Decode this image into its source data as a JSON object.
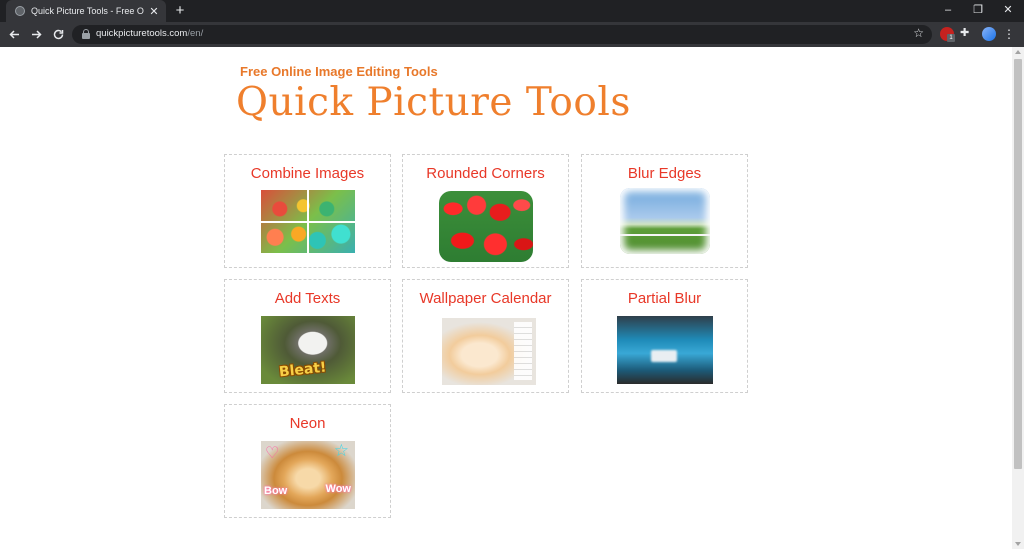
{
  "browser": {
    "tab_title": "Quick Picture Tools - Free Online",
    "tab_close": "✕",
    "new_tab": "+",
    "url_host": "quickpicturetools.com",
    "url_path": "/en/",
    "extension_badge": "1",
    "window_controls": {
      "minimize": "–",
      "restore": "❐",
      "close": "✕"
    },
    "icons": [
      "back-icon",
      "forward-icon",
      "reload-icon",
      "lock-icon",
      "star-icon",
      "puzzle-icon",
      "menu-icon"
    ]
  },
  "page": {
    "subtitle": "Free Online Image Editing Tools",
    "title": "Quick Picture Tools",
    "accent_color": "#ef7f2d",
    "label_color": "#e83828",
    "tools": [
      {
        "label": "Combine Images"
      },
      {
        "label": "Rounded Corners"
      },
      {
        "label": "Blur Edges"
      },
      {
        "label": "Add Texts",
        "thumb_text": "Bleat!"
      },
      {
        "label": "Wallpaper Calendar"
      },
      {
        "label": "Partial Blur"
      },
      {
        "label": "Neon",
        "thumb_text_left": "Bow",
        "thumb_text_right": "Wow"
      }
    ]
  }
}
